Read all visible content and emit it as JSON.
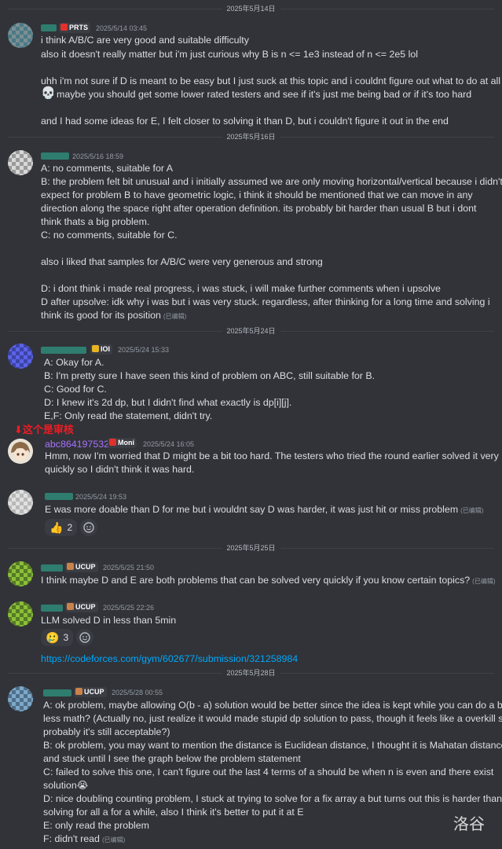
{
  "dividers": [
    "2025年5月14日",
    "2025年5月16日",
    "2025年5月24日",
    "2025年5月25日",
    "2025年5月28日"
  ],
  "messages": [
    {
      "role": "PRTS",
      "timestamp": "2025/5/14 03:45",
      "lines": [
        "i think A/B/C are very good and suitable difficulty",
        "also it doesn't really matter but i'm just curious why B is n <= 1e3 instead of n <= 2e5 lol",
        "",
        "uhh i'm not sure if D is meant to be easy but I just suck at this topic and i couldnt figure out what to do at all",
        "maybe you should get some lower rated testers and see if it's just me being bad or if it's too hard",
        "",
        "and I had some ideas for E, I felt closer to solving it than D, but i couldn't figure it out in the end"
      ]
    },
    {
      "role": "",
      "timestamp": "2025/5/16 18:59",
      "lines": [
        "A: no comments, suitable for A",
        "B: the problem felt bit unusual and i initially assumed we are only moving horizontal/vertical because i didn't",
        "expect for problem B to have geometric logic, i think it should be mentioned that we can move in any",
        "direction along the space right after operation definition. its probably bit harder than usual B but i dont",
        "think thats a big problem.",
        "C: no comments, suitable for C.",
        "",
        "also i liked that samples for A/B/C were very generous and strong",
        "",
        "D: i dont think i made real progress, i was stuck, i will make further comments when i upsolve",
        "D after upsolve: idk why i was but i was very stuck. regardless, after thinking for a long time and solving i",
        "think its good for its position"
      ],
      "edited": "(已编辑)"
    },
    {
      "role": "IOI",
      "timestamp": "2025/5/24 15:33",
      "lines": [
        "A: Okay for A.",
        "B: I'm pretty sure I have seen this kind of problem on ABC, still suitable for B.",
        "C: Good for C.",
        "D: I knew it's 2d dp, but I didn't find what exactly is dp[i][j].",
        "E,F: Only read the statement, didn't try."
      ]
    },
    {
      "annotation": "⬇这个是审核",
      "username": "abc864197532",
      "role": "Moni",
      "timestamp": "2025/5/24 16:05",
      "lines": [
        "Hmm, now I'm worried that D might be a bit too hard. The testers who tried the round earlier solved it very",
        "quickly so I didn't think it was hard."
      ]
    },
    {
      "role": "",
      "timestamp": "2025/5/24 19:53",
      "lines": [
        "E was more doable than D for me but i wouldnt say D was harder, it was just hit or miss problem"
      ],
      "edited": "(已编辑)",
      "reaction": {
        "emoji": "👍",
        "count": "2"
      }
    },
    {
      "role": "UCUP",
      "timestamp": "2025/5/25 21:50",
      "lines": [
        "I think maybe D and E are both problems that can be solved very quickly if you know certain topics?"
      ],
      "edited": "(已编辑)"
    },
    {
      "role": "UCUP",
      "timestamp": "2025/5/25 22:26",
      "lines": [
        "LLM solved D in less than 5min"
      ],
      "reaction": {
        "emoji": "🥲",
        "count": "3"
      },
      "link": "https://codeforces.com/gym/602677/submission/321258984"
    },
    {
      "role": "UCUP",
      "timestamp": "2025/5/28 00:55",
      "lines": [
        "A: ok problem, maybe allowing O(b - a) solution would be better since the idea is kept while you can do a bit",
        "less math? (Actually no, just realize it would made stupid dp solution to pass, though it feels like a overkill so",
        "probably it's still acceptable?)",
        "B: ok problem, you may want to mention the distance is Euclidean distance, I thought it is Mahatan distance",
        "and stuck until I see the graph below the problem statement",
        "C: failed to solve this one, I can't figure out the last 4 terms of a should be when n is even and there exist",
        "solution😭",
        "D: nice doubling counting problem, I stuck at trying to solve for a fix array a but turns out this is harder than",
        "solving for all a for a while, also I think it's better to put it at E",
        "E: only read the problem",
        "F: didn't read"
      ],
      "edited": "(已编辑)"
    }
  ],
  "skull_emoji": "💀",
  "watermark": "洛谷",
  "colors": {
    "background": "#313338",
    "text": "#dbdee1",
    "timestamp": "#949ba4",
    "link": "#00a8fc",
    "annotation": "#ed1c24",
    "username": "#a970ff"
  }
}
